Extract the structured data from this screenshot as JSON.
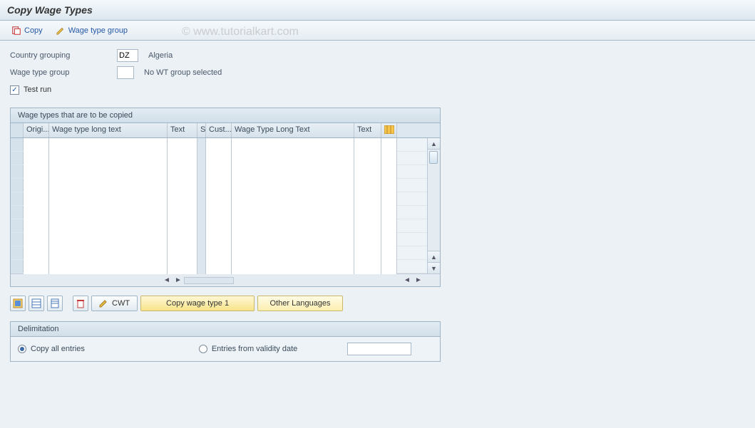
{
  "title": "Copy Wage Types",
  "toolbar": {
    "copy_label": "Copy",
    "wage_type_group_label": "Wage type group"
  },
  "fields": {
    "country_grouping_label": "Country grouping",
    "country_grouping_value": "DZ",
    "country_grouping_desc": "Algeria",
    "wage_type_group_label": "Wage type group",
    "wage_type_group_value": "",
    "wage_type_group_desc": "No WT group selected",
    "test_run_label": "Test run",
    "test_run_checked": true
  },
  "grid": {
    "title": "Wage types that are to be copied",
    "columns": {
      "origi": "Origi...",
      "wtlt": "Wage type long text",
      "text": "Text",
      "s": "S",
      "cust": "Cust...",
      "wtlt2": "Wage Type Long Text",
      "text2": "Text"
    },
    "row_count": 10
  },
  "buttons": {
    "cwt": "CWT",
    "copy_wage_type_1": "Copy wage type 1",
    "other_languages": "Other Languages"
  },
  "delimitation": {
    "title": "Delimitation",
    "copy_all": "Copy all entries",
    "entries_from": "Entries from validity date",
    "date_value": ""
  },
  "watermark": "© www.tutorialkart.com"
}
